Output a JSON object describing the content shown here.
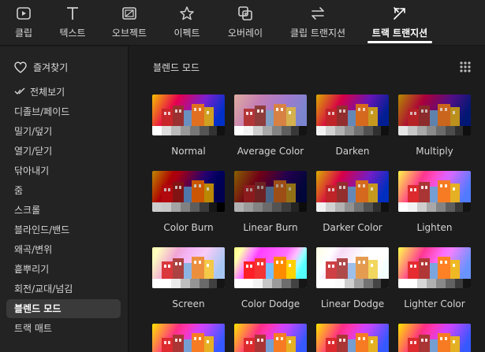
{
  "tabs": [
    {
      "label": "클립",
      "icon": "clip-icon"
    },
    {
      "label": "텍스트",
      "icon": "text-icon"
    },
    {
      "label": "오브젝트",
      "icon": "object-icon"
    },
    {
      "label": "이펙트",
      "icon": "effect-icon"
    },
    {
      "label": "오버레이",
      "icon": "overlay-icon"
    },
    {
      "label": "클립 트랜지션",
      "icon": "clip-transition-icon"
    },
    {
      "label": "트랙 트랜지션",
      "icon": "track-transition-icon",
      "active": true
    }
  ],
  "sidebar": {
    "favorites_label": "즐겨찾기",
    "items": [
      {
        "label": "전체보기",
        "icon": "check-icon"
      },
      {
        "label": "디졸브/페이드"
      },
      {
        "label": "밀기/덮기"
      },
      {
        "label": "열기/닫기"
      },
      {
        "label": "닦아내기"
      },
      {
        "label": "줌"
      },
      {
        "label": "스크롤"
      },
      {
        "label": "블라인드/밴드"
      },
      {
        "label": "왜곡/변위"
      },
      {
        "label": "흩뿌리기"
      },
      {
        "label": "회전/교대/넘김"
      },
      {
        "label": "블렌드 모드",
        "active": true
      },
      {
        "label": "트랙 매트"
      }
    ]
  },
  "main": {
    "title": "블렌드 모드",
    "cards": [
      {
        "label": "Normal",
        "style": "normal"
      },
      {
        "label": "Average Color",
        "style": "average"
      },
      {
        "label": "Darken",
        "style": "darken"
      },
      {
        "label": "Multiply",
        "style": "multiply"
      },
      {
        "label": "Color Burn",
        "style": "colorburn"
      },
      {
        "label": "Linear Burn",
        "style": "linearburn"
      },
      {
        "label": "Darker Color",
        "style": "darkercolor"
      },
      {
        "label": "Lighten",
        "style": "lighten"
      },
      {
        "label": "Screen",
        "style": "screen"
      },
      {
        "label": "Color Dodge",
        "style": "colordodge"
      },
      {
        "label": "Linear Dodge",
        "style": "lineardodge"
      },
      {
        "label": "Lighter Color",
        "style": "lightercolor"
      },
      {
        "label": "",
        "style": "row4"
      },
      {
        "label": "",
        "style": "row4"
      },
      {
        "label": "",
        "style": "row4"
      },
      {
        "label": "",
        "style": "row4"
      }
    ]
  },
  "colors": {
    "accent": "#ffffff",
    "background": "#1b1b1b",
    "panel": "#232323",
    "selected": "#3a3a3a"
  }
}
